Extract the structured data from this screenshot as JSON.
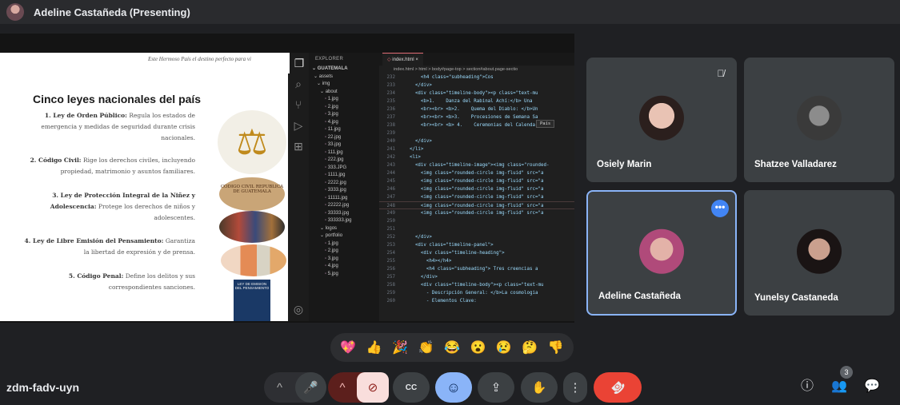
{
  "presenting_bar": {
    "title": "Adeline Castañeda (Presenting)"
  },
  "slide": {
    "banner": "Este Hermoso País el destino perfecto para vi",
    "heading": "Cinco leyes nacionales del país",
    "laws": [
      {
        "title": "1. Ley de Orden Público:",
        "text": "Regula los estados de emergencia y medidas de seguridad durante crisis nacionales."
      },
      {
        "title": "2. Código Civil:",
        "text": "Rige los derechos civiles, incluyendo propiedad, matrimonio y asuntos familiares."
      },
      {
        "title": "3. Ley de Protección Integral de la Niñez y Adolescencia:",
        "text": "Protege los derechos de niños y adolescentes."
      },
      {
        "title": "4. Ley de Libre Emisión del Pensamiento:",
        "text": "Garantiza la libertad de expresión y de prensa."
      },
      {
        "title": "5. Código Penal:",
        "text": "Define los delitos y sus correspondientes sanciones."
      }
    ],
    "images": {
      "code_book": "CODIGO CIVIL REPUBLICA DE GUATEMALA",
      "poster": "LEY DE EMISION DEL PENSAMIENTO"
    }
  },
  "vscode": {
    "explorer_title": "EXPLORER",
    "project": "GUATEMALA",
    "files": [
      "assets",
      "img",
      "about",
      "1.jpg",
      "2.jpg",
      "3.jpg",
      "4.jpg",
      "11.jpg",
      "22.jpg",
      "33.jpg",
      "111.jpg",
      "222.jpg",
      "333.JPG",
      "1111.jpg",
      "2222.jpg",
      "3333.jpg",
      "11111.jpg",
      "22222.jpg",
      "33333.jpg",
      "333333.jpg",
      "logos",
      "portfolio",
      "1.jpg",
      "2.jpg",
      "3.jpg",
      "4.jpg",
      "5.jpg"
    ],
    "tab": "index.html",
    "breadcrumb": "index.html > html > body#page-top > section#about.page-sectio",
    "tooltip": "País",
    "lines": [
      {
        "n": "232",
        "t": "        <h4 class=\"subheading\">Cos"
      },
      {
        "n": "233",
        "t": "      </div>"
      },
      {
        "n": "234",
        "t": "      <div class=\"timeline-body\"><p class=\"text-mu"
      },
      {
        "n": "235",
        "t": "        <b>1.    Danza del Rabinal Achí:</b> Una"
      },
      {
        "n": "236",
        "t": "        <br><br> <b>2.    Quema del Diablo: </b>Un"
      },
      {
        "n": "237",
        "t": "        <br><br> <b>3.    Procesiones de Semana Sa"
      },
      {
        "n": "238",
        "t": "        <br><br> <b> 4.    Ceremonias del Calendari"
      },
      {
        "n": "239",
        "t": ""
      },
      {
        "n": "240",
        "t": "      </div>"
      },
      {
        "n": "241",
        "t": "    </li>"
      },
      {
        "n": "242",
        "t": "    <li>"
      },
      {
        "n": "243",
        "t": "      <div class=\"timeline-image\"><img class=\"rounded-"
      },
      {
        "n": "244",
        "t": "        <img class=\"rounded-circle img-fluid\" src=\"a"
      },
      {
        "n": "245",
        "t": "        <img class=\"rounded-circle img-fluid\" src=\"a"
      },
      {
        "n": "246",
        "t": "        <img class=\"rounded-circle img-fluid\" src=\"a"
      },
      {
        "n": "247",
        "t": "        <img class=\"rounded-circle img-fluid\" src=\"a"
      },
      {
        "n": "248",
        "t": "        <img class=\"rounded-circle img-fluid\" src=\"a"
      },
      {
        "n": "249",
        "t": "        <img class=\"rounded-circle img-fluid\" src=\"a"
      },
      {
        "n": "250",
        "t": ""
      },
      {
        "n": "251",
        "t": ""
      },
      {
        "n": "252",
        "t": "      </div>"
      },
      {
        "n": "253",
        "t": "      <div class=\"timeline-panel\">"
      },
      {
        "n": "254",
        "t": "        <div class=\"timeline-heading\">"
      },
      {
        "n": "255",
        "t": "          <h4></h4>"
      },
      {
        "n": "256",
        "t": "          <h4 class=\"subheading\"> Tres creencias a"
      },
      {
        "n": "257",
        "t": "        </div>"
      },
      {
        "n": "258",
        "t": "        <div class=\"timeline-body\"><p class=\"text-mu"
      },
      {
        "n": "259",
        "t": "          - Descripción General: </b>La cosmologia"
      },
      {
        "n": "260",
        "t": "          - Elementos Clave:"
      }
    ]
  },
  "participants": [
    {
      "name": "Osiely Marin",
      "muted": true
    },
    {
      "name": "Shatzee Valladarez"
    },
    {
      "name": "Adeline Castañeda",
      "active": true
    },
    {
      "name": "Yunelsy Castaneda"
    }
  ],
  "reactions": [
    "💖",
    "👍",
    "🎉",
    "👏",
    "😂",
    "😮",
    "😢",
    "🤔",
    "👎"
  ],
  "bottom": {
    "meeting_code": "zdm-fadv-uyn",
    "people_count": "3",
    "icons": {
      "chevron": "^",
      "mic": "🎤",
      "camera_off": "⊘",
      "captions": "CC",
      "emoji": "☺",
      "present": "⇪",
      "hand": "✋",
      "more": "⋮",
      "end_call": "☎",
      "info": "ⓘ",
      "people": "👥",
      "chat": "💬"
    },
    "colors": {
      "end_call": "#ea4335",
      "camera_off_bg": "#f9dedc",
      "emoji_bg": "#8ab4f8"
    }
  }
}
